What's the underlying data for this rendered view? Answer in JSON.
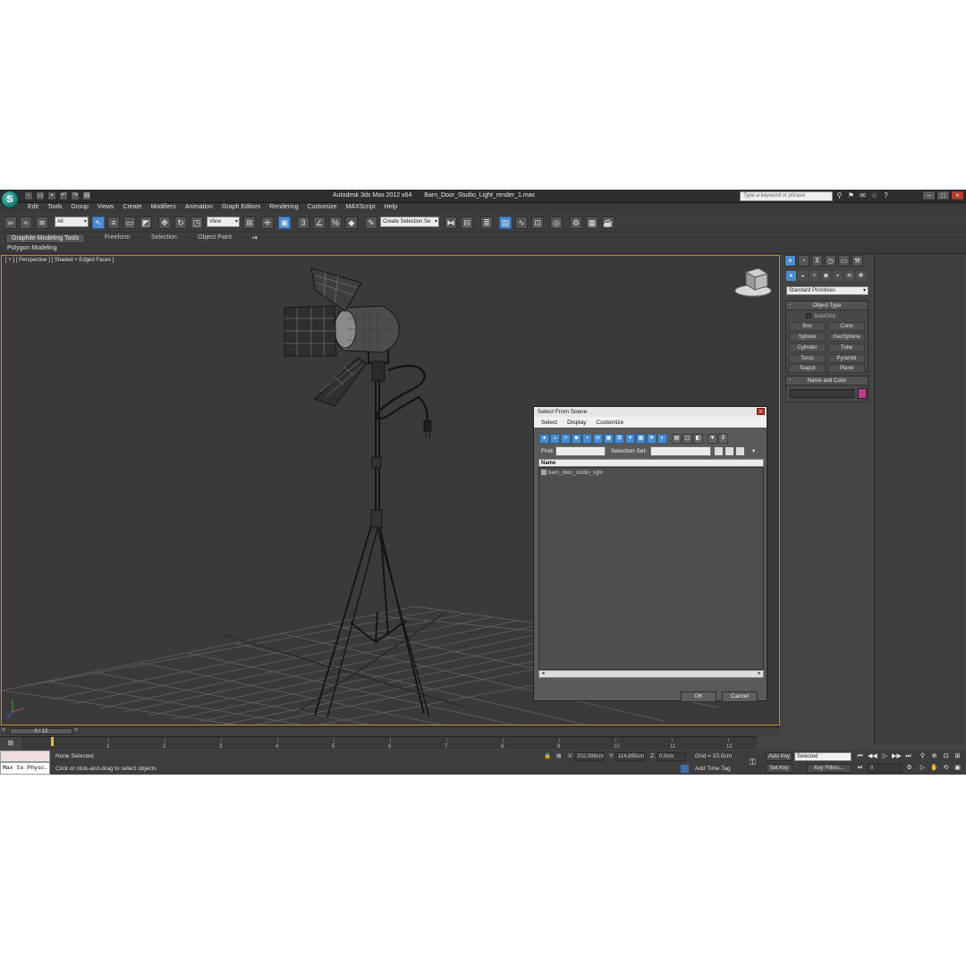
{
  "window": {
    "app_title": "Autodesk 3ds Max  2012 x64",
    "file_name": "Barn_Door_Studio_Light_render_1.max",
    "search_placeholder": "Type a keyword or phrase"
  },
  "menu": [
    "Edit",
    "Tools",
    "Group",
    "Views",
    "Create",
    "Modifiers",
    "Animation",
    "Graph Editors",
    "Rendering",
    "Customize",
    "MAXScript",
    "Help"
  ],
  "toolbar": {
    "selection_filter": "All",
    "reference_coord": "View",
    "named_selection": "Create Selection Se"
  },
  "ribbon": {
    "tabs": [
      "Graphite Modeling Tools",
      "Freeform",
      "Selection",
      "Object Paint"
    ],
    "active_panel": "Polygon Modeling"
  },
  "viewport": {
    "label": "[ + ] [ Perspective ] [ Shaded + Edged Faces ]"
  },
  "command_panel": {
    "category": "Standard Primitives",
    "object_type_title": "Object Type",
    "autogrid_label": "AutoGrid",
    "object_buttons": [
      "Box",
      "Cone",
      "Sphere",
      "GeoSphere",
      "Cylinder",
      "Tube",
      "Torus",
      "Pyramid",
      "Teapot",
      "Plane"
    ],
    "name_color_title": "Name and Color",
    "object_color": "#c03a8a"
  },
  "dialog": {
    "title": "Select From Scene",
    "menu": [
      "Select",
      "Display",
      "Customize"
    ],
    "find_label": "Find:",
    "selection_set_label": "Selection Set:",
    "column_header": "Name",
    "items": [
      "barn_door_studio_light"
    ],
    "ok_label": "OK",
    "cancel_label": "Cancel"
  },
  "timeline": {
    "frame_indicator": "0 / 12",
    "ticks": [
      "1",
      "2",
      "3",
      "4",
      "5",
      "6",
      "7",
      "8",
      "9",
      "10",
      "11",
      "12"
    ]
  },
  "status": {
    "maxscript_listener": "Max to Physc.",
    "selection_info": "None Selected",
    "prompt": "Click or click-and-drag to select objects",
    "x_label": "X:",
    "x_value": "202,098cm",
    "y_label": "Y:",
    "y_value": "114,895cm",
    "z_label": "Z:",
    "z_value": "0,0cm",
    "grid": "Grid = 10,0cm",
    "add_time_tag": "Add Time Tag",
    "auto_key": "Auto Key",
    "set_key": "Set Key",
    "key_mode": "Selected",
    "key_filters": "Key Filters...",
    "current_frame": "0"
  }
}
